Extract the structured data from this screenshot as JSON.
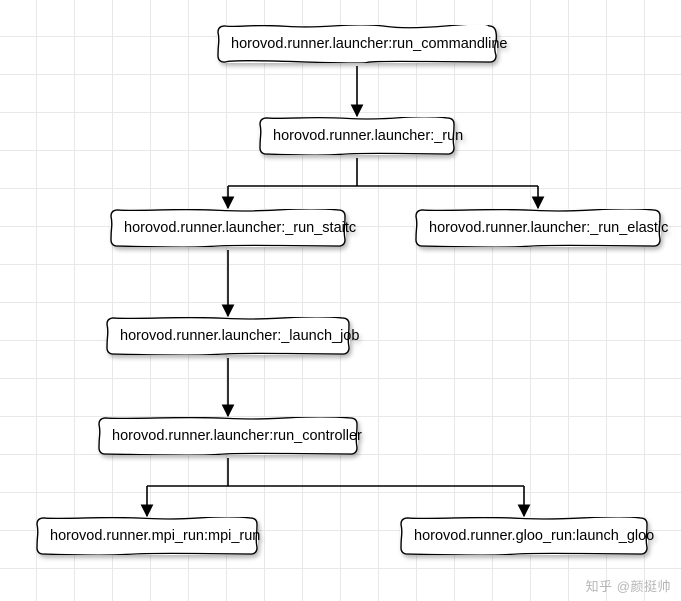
{
  "chart_data": {
    "type": "flowchart",
    "nodes": [
      {
        "id": "n1",
        "label": "horovod.runner.launcher:run_commandline"
      },
      {
        "id": "n2",
        "label": "horovod.runner.launcher:_run"
      },
      {
        "id": "n3",
        "label": "horovod.runner.launcher:_run_staitc"
      },
      {
        "id": "n4",
        "label": "horovod.runner.launcher:_run_elastic"
      },
      {
        "id": "n5",
        "label": "horovod.runner.launcher:_launch_job"
      },
      {
        "id": "n6",
        "label": "horovod.runner.launcher:run_controller"
      },
      {
        "id": "n7",
        "label": "horovod.runner.mpi_run:mpi_run"
      },
      {
        "id": "n8",
        "label": "horovod.runner.gloo_run:launch_gloo"
      }
    ],
    "edges": [
      {
        "from": "n1",
        "to": "n2"
      },
      {
        "from": "n2",
        "to": "n3"
      },
      {
        "from": "n2",
        "to": "n4"
      },
      {
        "from": "n3",
        "to": "n5"
      },
      {
        "from": "n5",
        "to": "n6"
      },
      {
        "from": "n6",
        "to": "n7"
      },
      {
        "from": "n6",
        "to": "n8"
      }
    ]
  },
  "watermark": {
    "brand": "知乎",
    "at": "@颜挺帅"
  }
}
